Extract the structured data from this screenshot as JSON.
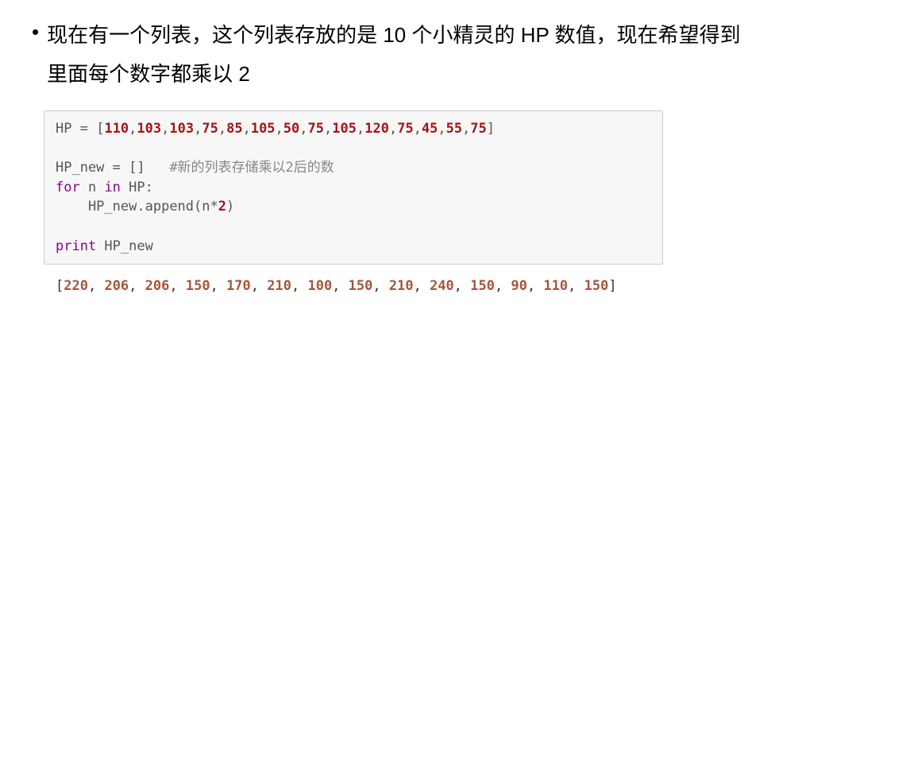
{
  "bullet": {
    "marker": "•",
    "text_line1": "现在有一个列表，这个列表存放的是 10 个小精灵的 HP 数值，现在希望得到",
    "text_line2": "里面每个数字都乘以 2"
  },
  "code": {
    "hp_var": "HP",
    "eq": " = ",
    "open_bracket": "[",
    "close_bracket": "]",
    "hp_values": [
      "110",
      "103",
      "103",
      "75",
      "85",
      "105",
      "50",
      "75",
      "105",
      "120",
      "75",
      "45",
      "55",
      "75"
    ],
    "comma": ",",
    "hpnew_var": "HP_new",
    "empty_list": " = []   ",
    "comment": "#新的列表存储乘以2后的数",
    "for_kw": "for",
    "n_var": " n ",
    "in_kw": "in",
    "hp_ref": " HP:",
    "indent": "    HP_new",
    "append_dot": ".",
    "append_fn": "append",
    "append_open": "(n*",
    "two": "2",
    "append_close": ")",
    "print_kw": "print",
    "print_arg": " HP_new"
  },
  "output": {
    "open_bracket": "[",
    "close_bracket": "]",
    "values": [
      "220",
      "206",
      "206",
      "150",
      "170",
      "210",
      "100",
      "150",
      "210",
      "240",
      "150",
      "90",
      "110",
      "150"
    ],
    "sep": ", "
  }
}
